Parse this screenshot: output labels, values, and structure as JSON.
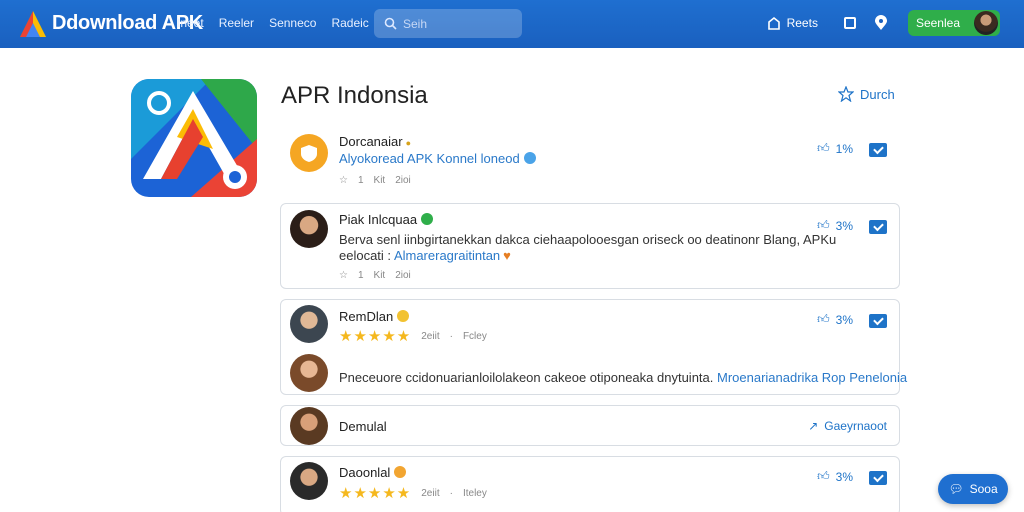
{
  "header": {
    "brand": "Ddownload APK",
    "nav": [
      "Ineet",
      "Reeler",
      "Senneco",
      "Radeic"
    ],
    "search_placeholder": "Seih",
    "right_label": "Reets",
    "cta_label": "Seenlea"
  },
  "app": {
    "title": "APR Indonsia",
    "watch_label": "Durch"
  },
  "reviews": [
    {
      "name": "Dorcanaiar",
      "subtitle": "Alyokoread APK Konnel loneod",
      "meta": [
        "1",
        "Kit",
        "2ioi"
      ],
      "stat": "1%"
    },
    {
      "name": "Piak Inlcquaa",
      "line1": "Berva senl iinbgirtanekkan dakca ciehaapolooesgan oriseck oo deatinonr Blang, APKu",
      "line2_plain": "eelocati : ",
      "line2_link": "Almareragraitintan",
      "meta": [
        "1",
        "Kit",
        "2ioi"
      ],
      "stat": "3%"
    },
    {
      "name": "RemDlan",
      "meta_time": "2eiit",
      "meta_tag": "Fcley",
      "stat": "3%",
      "body_plain": "Pneceuore ccidonuarianloilolakeon cakeoe otiponeaka dnytuinta.",
      "body_link": "Mroenarianadrika Rop Penelonia"
    },
    {
      "name": "Demulal",
      "action": "Gaeyrnaoot"
    },
    {
      "name": "Daoonlal",
      "meta_time": "2eiit",
      "meta_tag": "Iteley",
      "stat": "3%"
    }
  ],
  "chat_label": "Sooa",
  "colors": {
    "accent": "#1f6fd0",
    "green": "#2fae4a",
    "star": "#f5b81e"
  }
}
